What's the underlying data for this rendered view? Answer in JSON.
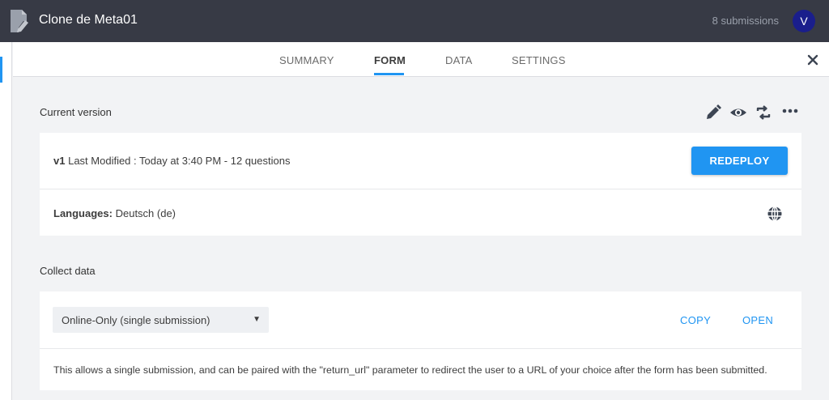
{
  "header": {
    "title": "Clone de Meta01",
    "submissions": "8 submissions",
    "avatar_initial": "V"
  },
  "tabs": [
    {
      "label": "SUMMARY",
      "active": false
    },
    {
      "label": "FORM",
      "active": true
    },
    {
      "label": "DATA",
      "active": false
    },
    {
      "label": "SETTINGS",
      "active": false
    }
  ],
  "current_version": {
    "section_title": "Current version",
    "toolbar_icons": [
      "pencil-icon",
      "eye-icon",
      "sync-icon",
      "more-icon"
    ],
    "version": "v1",
    "meta": "Last Modified : Today at 3:40 PM - 12 questions",
    "redeploy_label": "REDEPLOY",
    "languages_label": "Languages:",
    "languages_value": "Deutsch (de)"
  },
  "collect_data": {
    "section_title": "Collect data",
    "selected_option": "Online-Only (single submission)",
    "copy_label": "COPY",
    "open_label": "OPEN",
    "description": "This allows a single submission, and can be paired with the \"return_url\" parameter to redirect the user to a URL of your choice after the form has been submitted."
  },
  "colors": {
    "topbar": "#373a45",
    "accent": "#2095f2",
    "avatar": "#1a1e8c",
    "background": "#f2f3f5"
  }
}
